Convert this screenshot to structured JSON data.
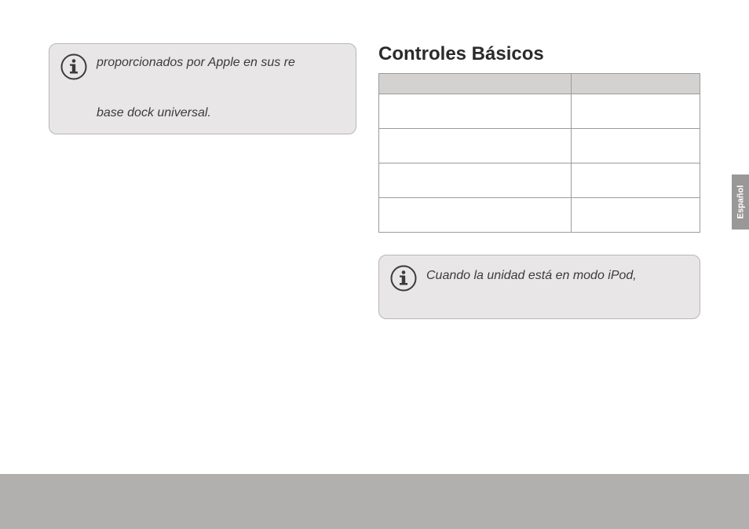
{
  "leftInfo": {
    "line1": "proporcionados por Apple en sus re",
    "line2": "base dock universal."
  },
  "heading": "Controles Básicos",
  "rightInfo": {
    "text": "Cuando la unidad está en modo iPod,"
  },
  "langTab": "Español",
  "table": {
    "columns": [
      "",
      ""
    ],
    "rows": [
      [
        "",
        ""
      ],
      [
        "",
        ""
      ],
      [
        "",
        ""
      ],
      [
        "",
        ""
      ]
    ]
  }
}
